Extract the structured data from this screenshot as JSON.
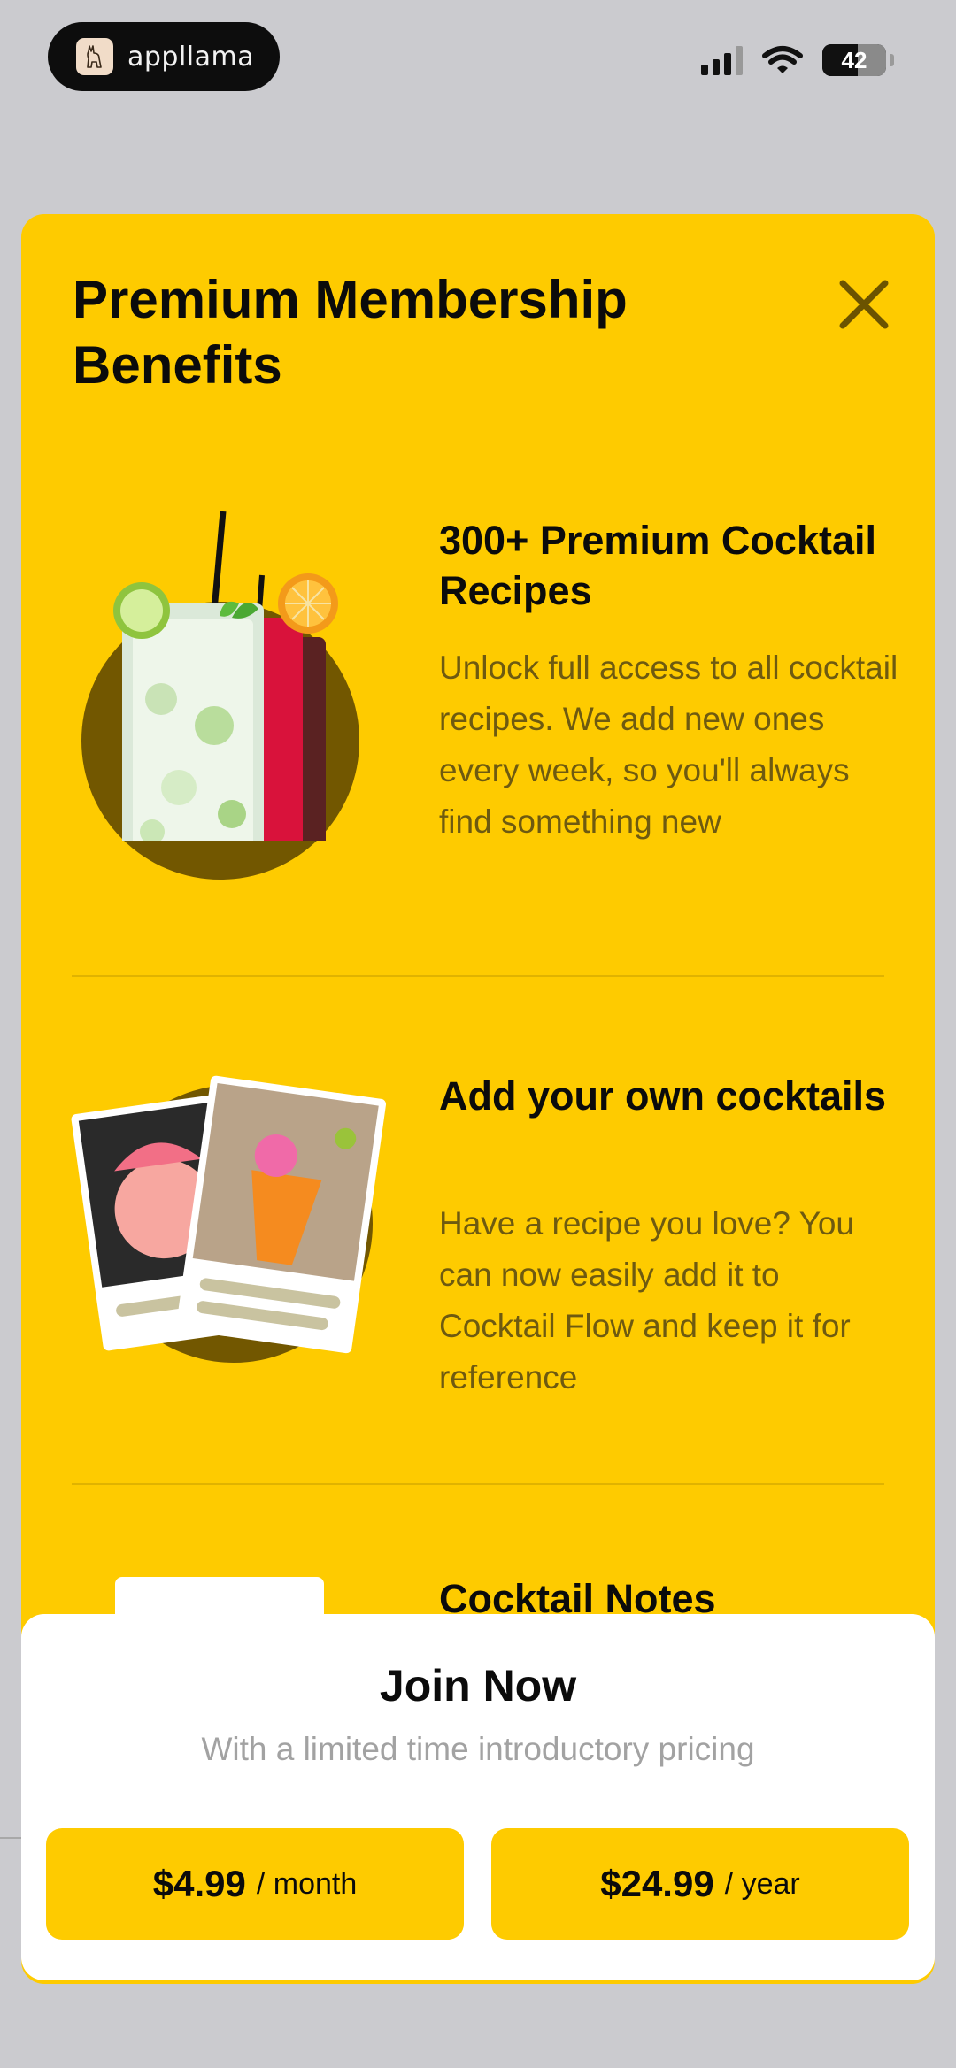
{
  "status_bar": {
    "app_name": "appllama",
    "battery": "42"
  },
  "sheet": {
    "title": "Premium Membership Benefits",
    "background": "#fecb00"
  },
  "benefits": [
    {
      "title": "300+ Premium Cocktail Recipes",
      "description": "Unlock full access to all cocktail recipes. We add new ones every week, so you'll always find something new"
    },
    {
      "title": "Add your own cocktails",
      "description": "Have a recipe you love? You can now easily add it to Cocktail Flow and keep it for reference"
    },
    {
      "title": "Cocktail Notes",
      "description": ""
    }
  ],
  "join": {
    "title": "Join Now",
    "subtitle": "With a limited time introductory pricing",
    "plans": [
      {
        "amount": "$4.99",
        "period": "/ month"
      },
      {
        "amount": "$24.99",
        "period": "/ year"
      }
    ]
  },
  "icons": {
    "close": "close-icon",
    "signal": "cellular-signal-icon",
    "wifi": "wifi-icon",
    "battery": "battery-icon"
  }
}
